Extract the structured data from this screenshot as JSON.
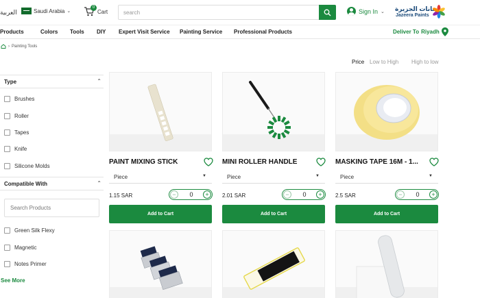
{
  "header": {
    "language": "العربية",
    "region": "Saudi Arabia",
    "cart_label": "Cart",
    "cart_count": "0",
    "search_placeholder": "search",
    "signin_label": "Sign In",
    "logo_arabic": "دهانات الجزيرة",
    "logo_english": "Jazeera Paints"
  },
  "nav": {
    "items": [
      "Products",
      "Colors",
      "Tools",
      "DIY",
      "Expert Visit Service",
      "Painting Service",
      "Professional Products"
    ],
    "deliver_label": "Deliver To",
    "deliver_city": "Riyadh"
  },
  "breadcrumb": {
    "current": "Painting Tools"
  },
  "sort": {
    "label": "Price",
    "low_to_high": "Low to High",
    "high_to_low": "High to low"
  },
  "filters": {
    "type_title": "Type",
    "type_options": [
      "Brushes",
      "Roller",
      "Tapes",
      "Knife",
      "Silicone Molds"
    ],
    "compatible_title": "Compatible With",
    "search_placeholder": "Search Products",
    "compatible_options": [
      "Green Silk Flexy",
      "Magnetic",
      "Notes Primer"
    ],
    "see_more": "See More"
  },
  "products": [
    {
      "title": "PAINT MIXING STICK",
      "unit": "Piece",
      "price": "1.15 SAR",
      "qty": "0",
      "add_label": "Add to Cart"
    },
    {
      "title": "MINI ROLLER HANDLE",
      "unit": "Piece",
      "price": "2.01 SAR",
      "qty": "0",
      "add_label": "Add to Cart"
    },
    {
      "title": "MASKING TAPE 16M - 1...",
      "unit": "Piece",
      "price": "2.5 SAR",
      "qty": "0",
      "add_label": "Add to Cart"
    }
  ],
  "colors": {
    "brand_green": "#1b8a3f",
    "logo_blue": "#1a4a7a"
  },
  "icons": [
    "cart-icon",
    "search-icon",
    "user-icon",
    "location-pin-icon",
    "home-icon",
    "heart-icon",
    "chevron-up-icon",
    "chevron-down-icon"
  ]
}
